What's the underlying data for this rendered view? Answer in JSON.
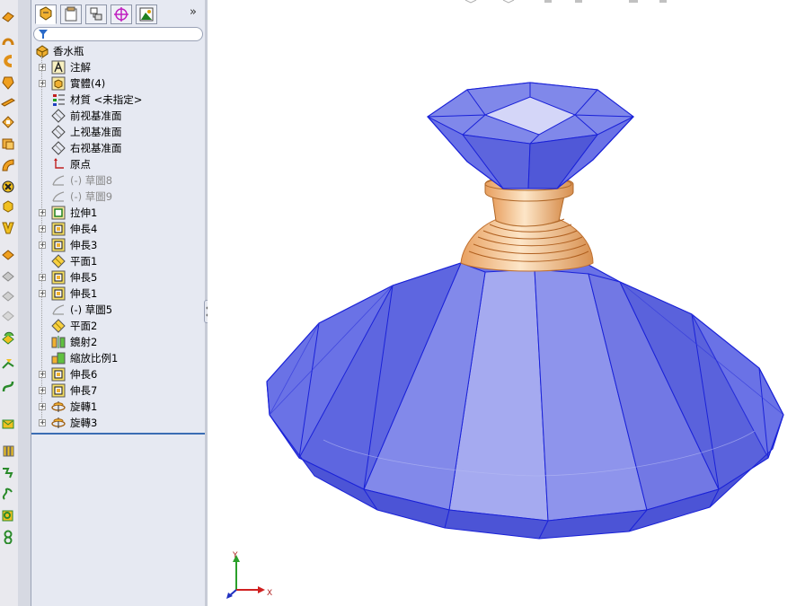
{
  "feature_tree": {
    "root": "香水瓶",
    "items": [
      {
        "label": "注解",
        "expandable": true,
        "icon": "annotations-icon",
        "dimmed": false
      },
      {
        "label": "實體(4)",
        "expandable": true,
        "icon": "solid-bodies-icon",
        "dimmed": false
      },
      {
        "label": "材質 <未指定>",
        "expandable": false,
        "icon": "material-icon",
        "dimmed": false
      },
      {
        "label": "前视基准面",
        "expandable": false,
        "icon": "plane-icon",
        "dimmed": false
      },
      {
        "label": "上视基准面",
        "expandable": false,
        "icon": "plane-icon",
        "dimmed": false
      },
      {
        "label": "右视基准面",
        "expandable": false,
        "icon": "plane-icon",
        "dimmed": false
      },
      {
        "label": "原点",
        "expandable": false,
        "icon": "origin-icon",
        "dimmed": false
      },
      {
        "label": "(-) 草圖8",
        "expandable": false,
        "icon": "sketch-icon",
        "dimmed": true
      },
      {
        "label": "(-) 草圖9",
        "expandable": false,
        "icon": "sketch-icon",
        "dimmed": true
      },
      {
        "label": "拉伸1",
        "expandable": true,
        "icon": "extrude-icon",
        "dimmed": false
      },
      {
        "label": "伸長4",
        "expandable": true,
        "icon": "boss-extrude-icon",
        "dimmed": false
      },
      {
        "label": "伸長3",
        "expandable": true,
        "icon": "boss-extrude-icon",
        "dimmed": false
      },
      {
        "label": "平面1",
        "expandable": false,
        "icon": "ref-plane-icon",
        "dimmed": false
      },
      {
        "label": "伸長5",
        "expandable": true,
        "icon": "boss-extrude-icon",
        "dimmed": false
      },
      {
        "label": "伸長1",
        "expandable": true,
        "icon": "boss-extrude-icon",
        "dimmed": false
      },
      {
        "label": "(-) 草圖5",
        "expandable": false,
        "icon": "sketch-icon",
        "dimmed": false
      },
      {
        "label": "平面2",
        "expandable": false,
        "icon": "ref-plane-icon",
        "dimmed": false
      },
      {
        "label": "鏡射2",
        "expandable": false,
        "icon": "mirror-icon",
        "dimmed": false
      },
      {
        "label": "縮放比例1",
        "expandable": false,
        "icon": "scale-icon",
        "dimmed": false
      },
      {
        "label": "伸長6",
        "expandable": true,
        "icon": "boss-extrude-icon",
        "dimmed": false
      },
      {
        "label": "伸長7",
        "expandable": true,
        "icon": "boss-extrude-icon",
        "dimmed": false
      },
      {
        "label": "旋轉1",
        "expandable": true,
        "icon": "revolve-icon",
        "dimmed": false
      },
      {
        "label": "旋轉3",
        "expandable": true,
        "icon": "revolve-icon",
        "dimmed": false
      }
    ]
  },
  "panel_tabs": [
    "feature-manager-tab",
    "property-manager-tab",
    "configuration-manager-tab",
    "dimxpert-tab",
    "display-manager-tab"
  ],
  "panel_more": "»",
  "triad": {
    "y": "Y",
    "x": "X"
  },
  "colors": {
    "body_blue": "#6a72e6",
    "edge_blue": "#1a22d8",
    "neck_orange": "#f0b880",
    "panel_bg": "#e6e9f2",
    "rollback_bar": "#3a6db3"
  }
}
